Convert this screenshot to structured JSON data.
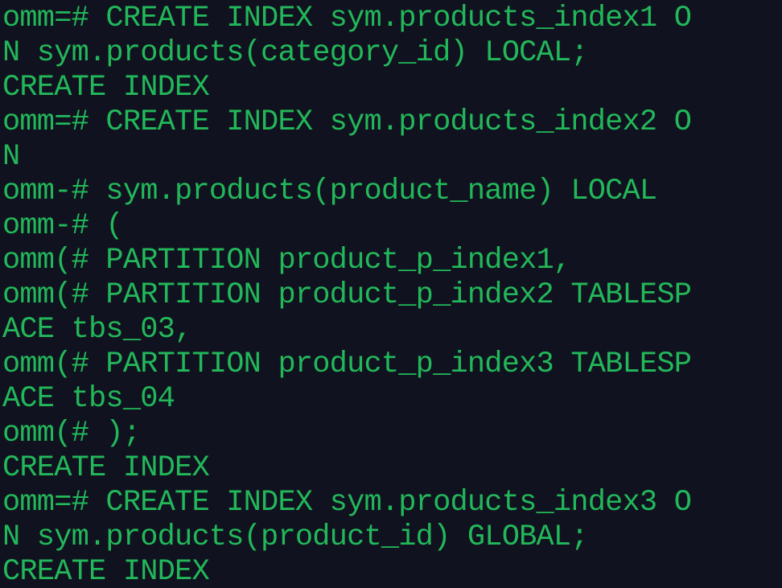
{
  "terminal": {
    "text_color": "#22b85a",
    "background_color": "#11121f",
    "lines": [
      "omm=# CREATE INDEX sym.products_index1 O",
      "N sym.products(category_id) LOCAL;",
      "CREATE INDEX",
      "omm=# CREATE INDEX sym.products_index2 O",
      "N",
      "omm-# sym.products(product_name) LOCAL",
      "omm-# (",
      "omm(# PARTITION product_p_index1,",
      "omm(# PARTITION product_p_index2 TABLESP",
      "ACE tbs_03,",
      "omm(# PARTITION product_p_index3 TABLESP",
      "ACE tbs_04",
      "omm(# );",
      "CREATE INDEX",
      "omm=# CREATE INDEX sym.products_index3 O",
      "N sym.products(product_id) GLOBAL;",
      "CREATE INDEX"
    ]
  }
}
